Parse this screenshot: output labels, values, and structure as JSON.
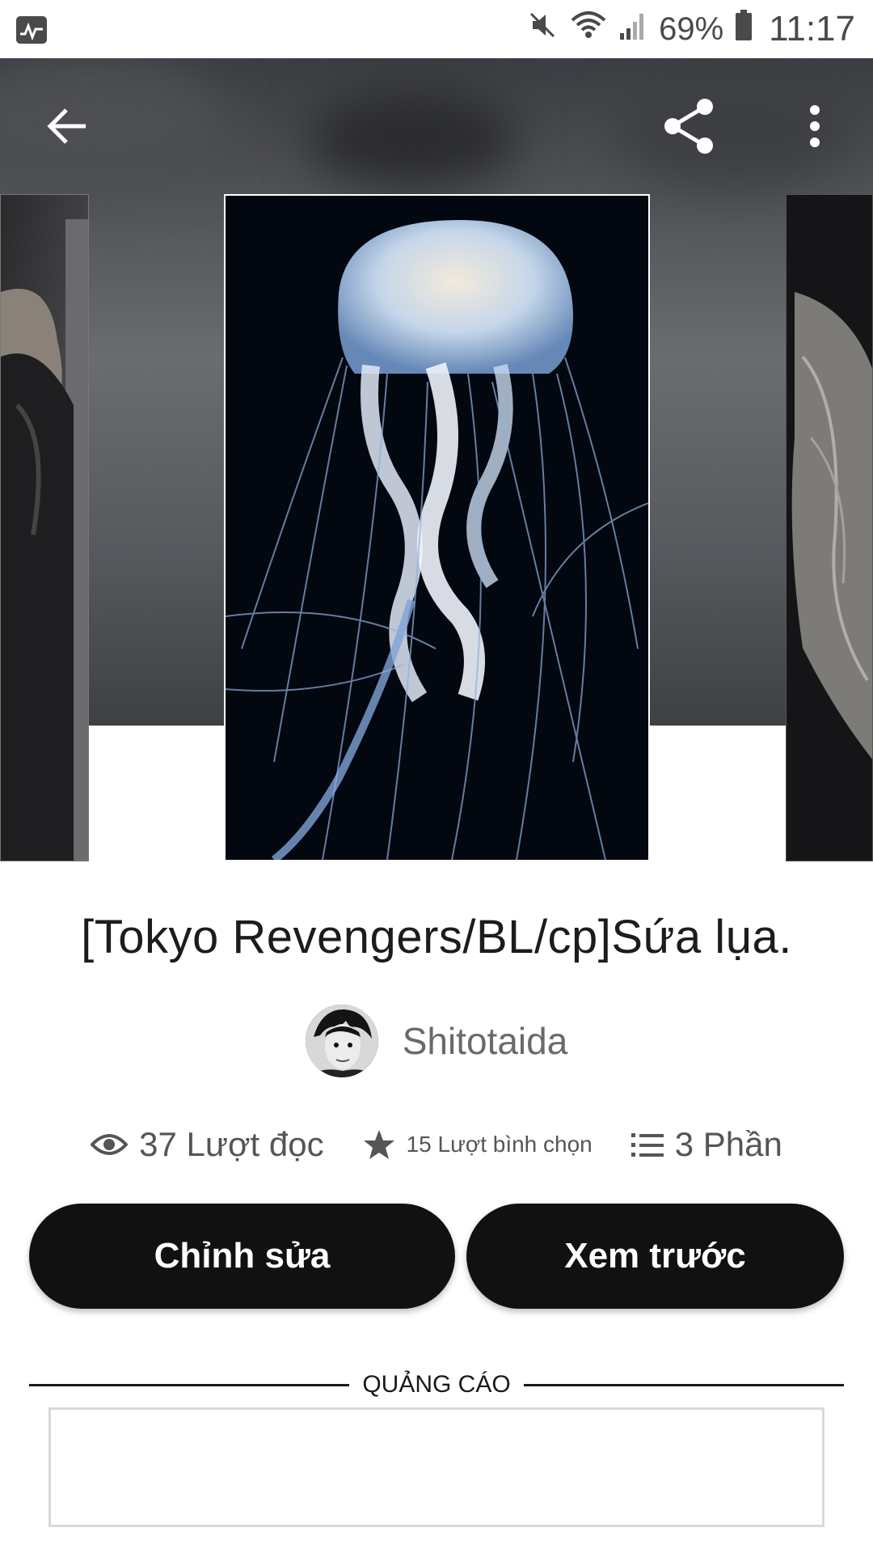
{
  "status_bar": {
    "battery_percent": "69%",
    "time": "11:17",
    "icons": [
      "activity-monitor-icon",
      "mute-icon",
      "wifi-icon",
      "signal-icon",
      "battery-icon"
    ]
  },
  "toolbar": {
    "back_icon": "arrow-left-icon",
    "share_icon": "share-icon",
    "more_icon": "more-vertical-icon"
  },
  "covers": {
    "main": "jellyfish",
    "left": "illustrated-figure",
    "right": "betta-fish"
  },
  "story": {
    "title": "[Tokyo Revengers/BL/cp]Sứa lụa.",
    "author": "Shitotaida",
    "stats": {
      "reads": "37 Lượt đọc",
      "votes": "15 Lượt bình chọn",
      "parts": "3 Phần"
    }
  },
  "actions": {
    "edit_label": "Chỉnh sửa",
    "preview_label": "Xem trước"
  },
  "ad": {
    "label": "QUẢNG CÁO"
  },
  "colors": {
    "button_bg": "#111111",
    "button_text": "#ffffff",
    "title_text": "#1c1c1c",
    "meta_text": "#555555"
  }
}
